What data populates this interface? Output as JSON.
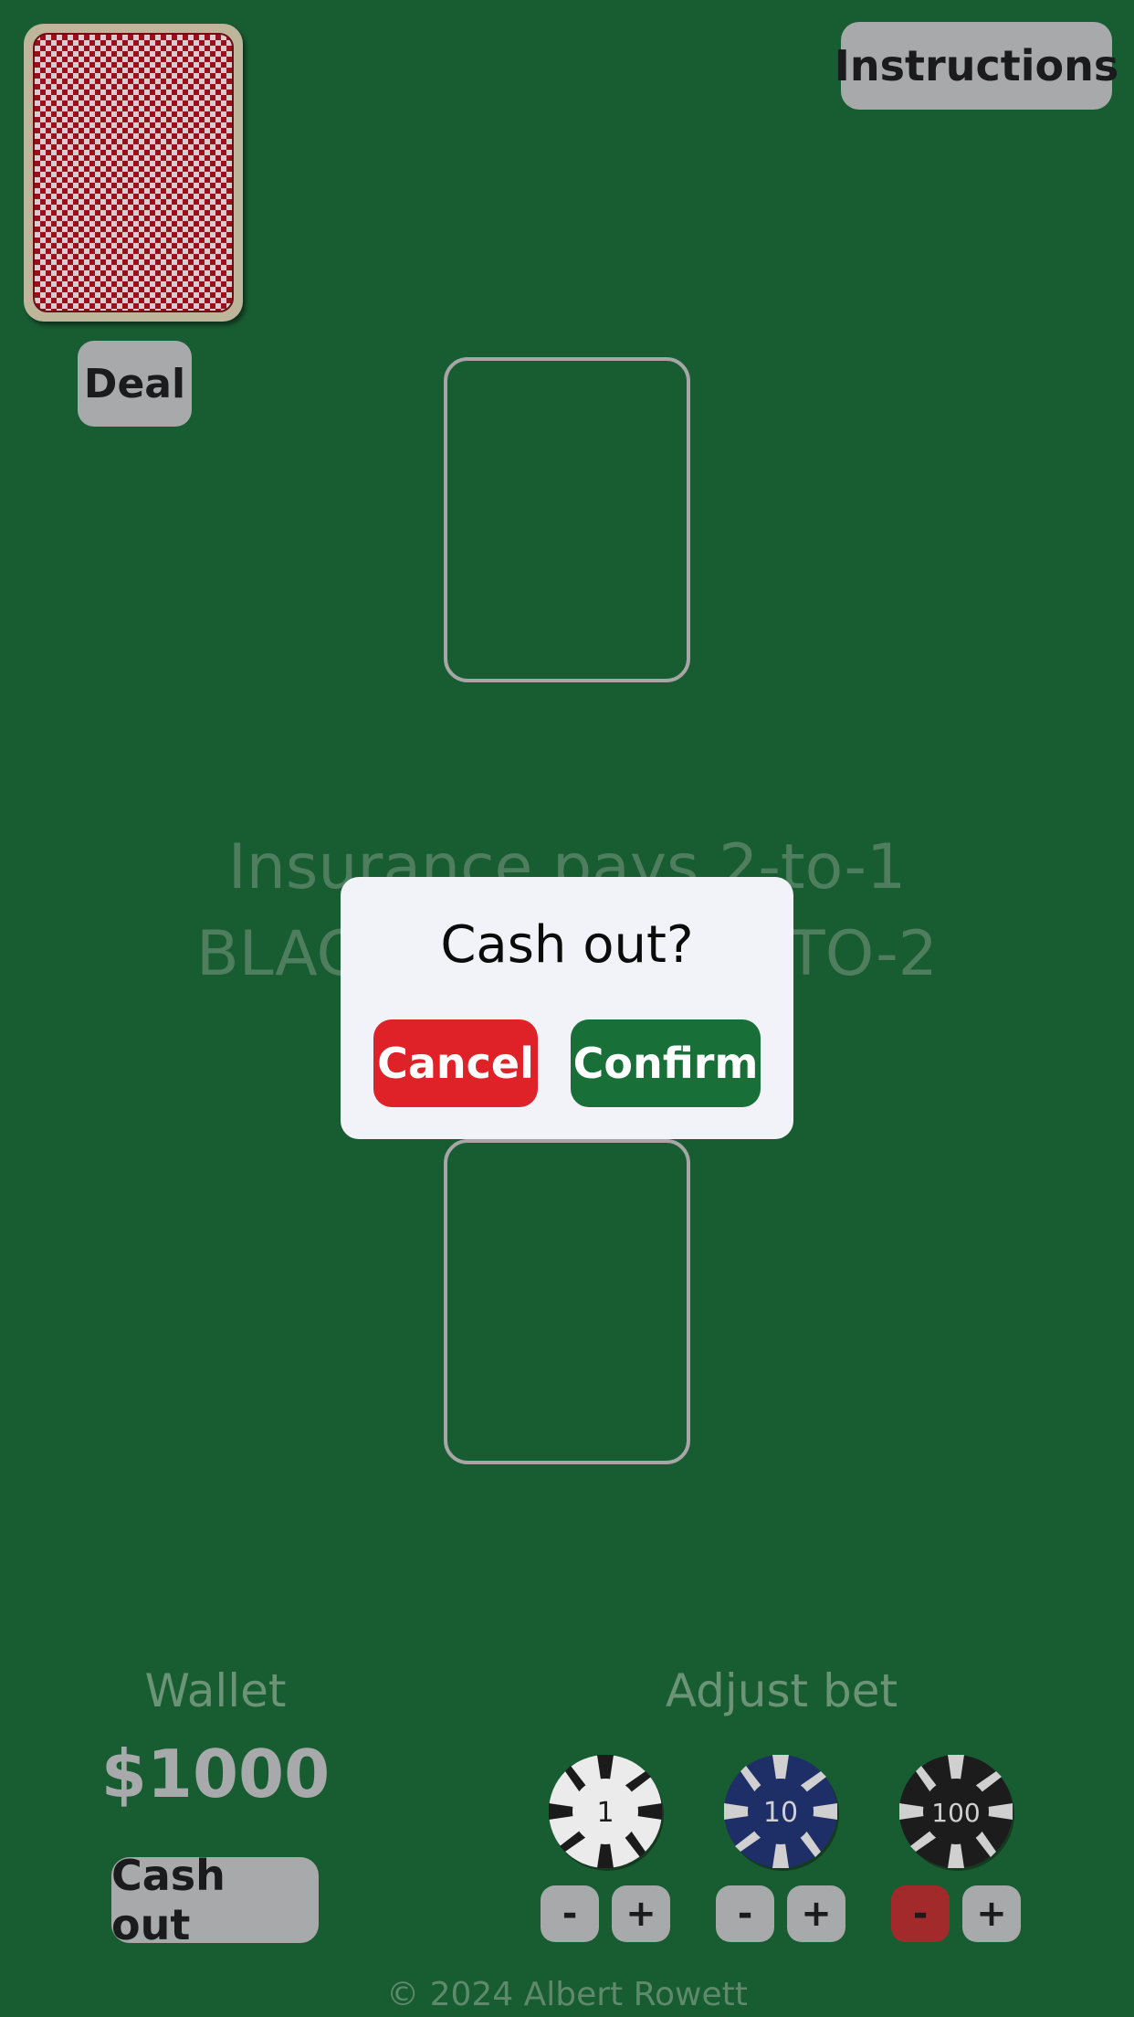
{
  "header": {
    "instructions_label": "Instructions",
    "deal_label": "Deal",
    "deck_icon": "card-back-icon"
  },
  "table": {
    "insurance_text": "Insurance pays 2-to-1",
    "blackjack_text": "BLACKJACK PAYS 3-TO-2"
  },
  "dialog": {
    "title": "Cash out?",
    "cancel_label": "Cancel",
    "confirm_label": "Confirm",
    "cancel_color": "#df2228",
    "confirm_color": "#187038"
  },
  "wallet": {
    "label": "Wallet",
    "amount": "$1000",
    "cash_out_label": "Cash out"
  },
  "bet": {
    "label": "Adjust bet",
    "chips": [
      {
        "value": "1",
        "color": "#ebebeb",
        "stripe": "#1b1b1b",
        "text": "#1b1b1b",
        "minus": "-",
        "plus": "+",
        "minus_disabled": false
      },
      {
        "value": "10",
        "color": "#1e2e66",
        "stripe": "#d0d0d0",
        "text": "#d0d0d0",
        "minus": "-",
        "plus": "+",
        "minus_disabled": false
      },
      {
        "value": "100",
        "color": "#1c1c1c",
        "stripe": "#d0d0d0",
        "text": "#d0d0d0",
        "minus": "-",
        "plus": "+",
        "minus_disabled": true
      }
    ]
  },
  "footer": {
    "copyright": "© 2024 Albert Rowett"
  }
}
